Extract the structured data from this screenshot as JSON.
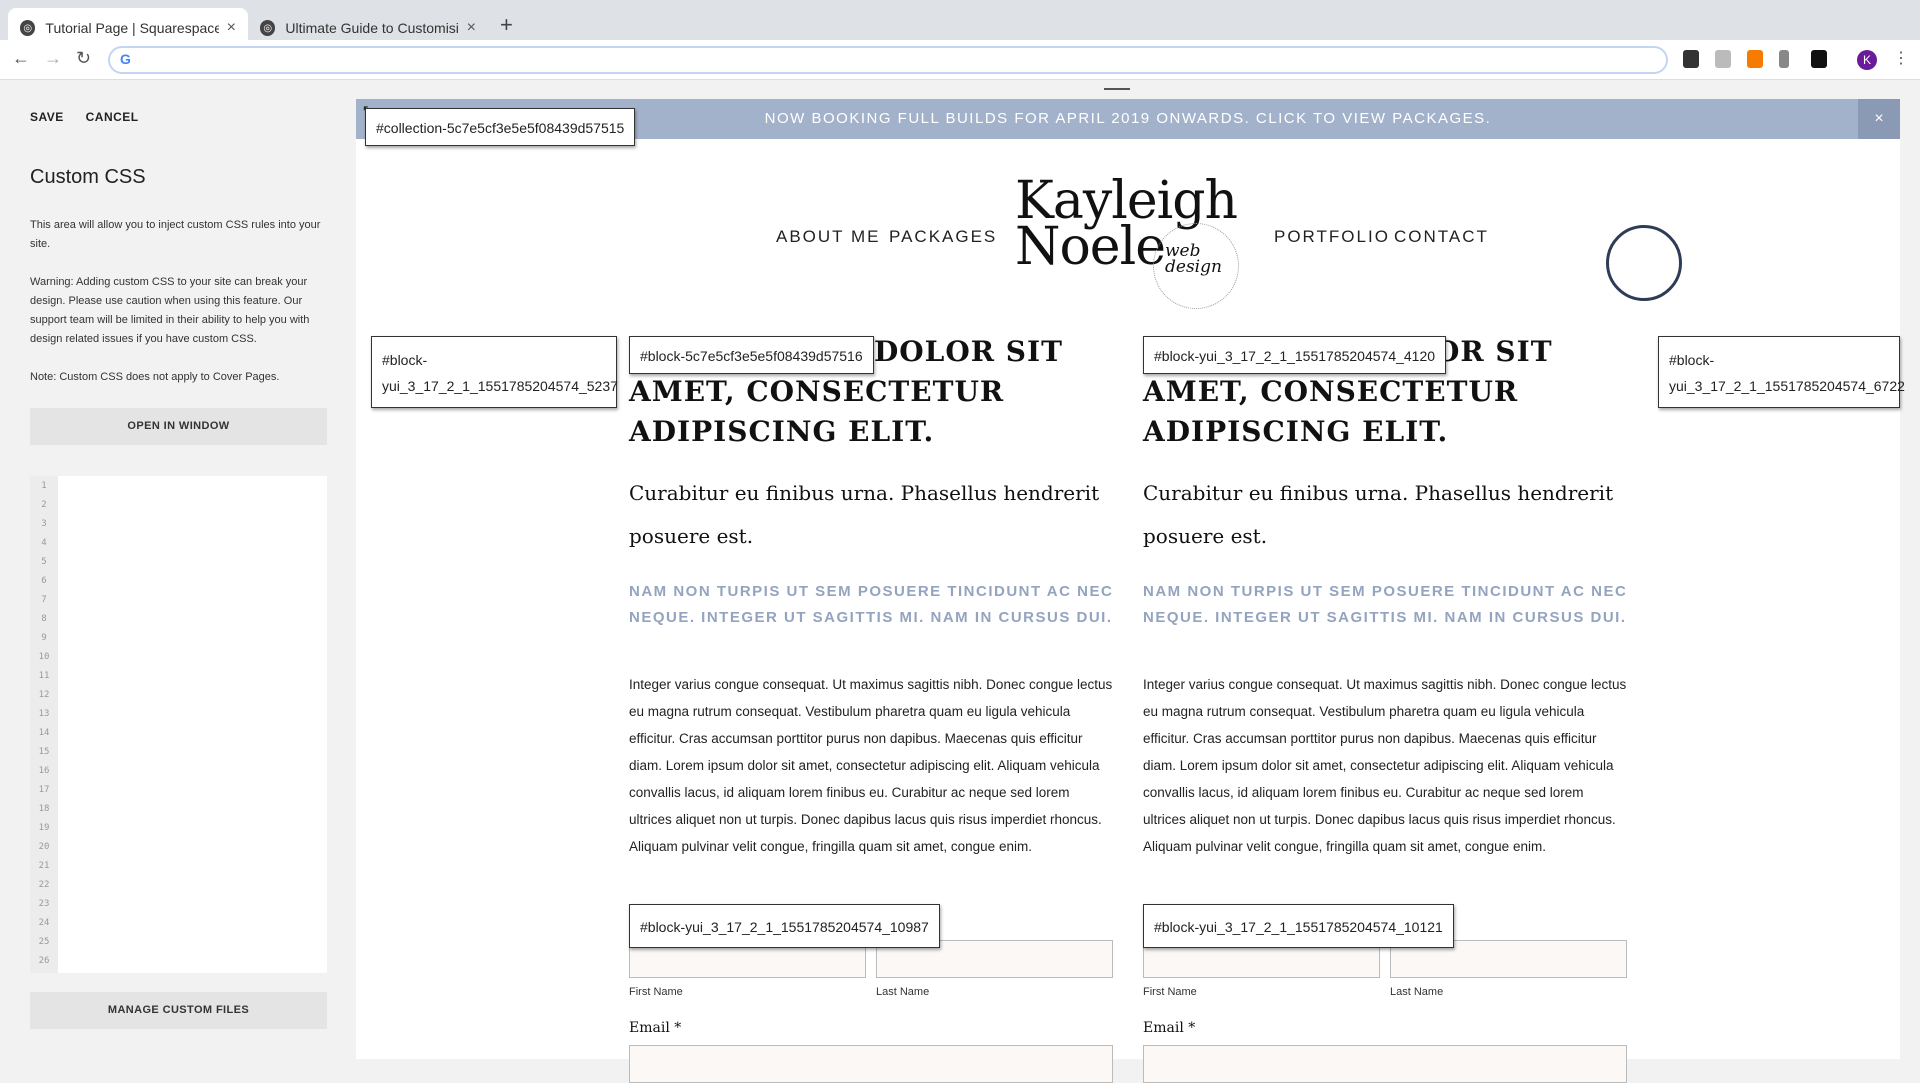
{
  "browser": {
    "tabs": [
      {
        "title": "Tutorial Page | Squarespace Dev",
        "active": true
      },
      {
        "title": "Ultimate Guide to Customising",
        "active": false
      }
    ],
    "new_tab": "+",
    "omnibox_icon": "G",
    "profile_initial": "K"
  },
  "panel": {
    "save": "SAVE",
    "cancel": "CANCEL",
    "title": "Custom CSS",
    "intro": "This area will allow you to inject custom CSS rules into your site.",
    "warning": "Warning: Adding custom CSS to your site can break your design. Please use caution when using this feature. Our support team will be limited in their ability to help you with design related issues if you have custom CSS.",
    "note": "Note: Custom CSS does not apply to Cover Pages.",
    "open_window": "OPEN IN WINDOW",
    "manage_files": "MANAGE CUSTOM FILES",
    "line_numbers": [
      "1",
      "2",
      "3",
      "4",
      "5",
      "6",
      "7",
      "8",
      "9",
      "10",
      "11",
      "12",
      "13",
      "14",
      "15",
      "16",
      "17",
      "18",
      "19",
      "20",
      "21",
      "22",
      "23",
      "24",
      "25",
      "26"
    ]
  },
  "site": {
    "banner": "NOW BOOKING FULL BUILDS FOR APRIL 2019 ONWARDS. CLICK TO VIEW PACKAGES.",
    "banner_close": "×",
    "nav": {
      "about": "ABOUT ME",
      "packages": "PACKAGES",
      "portfolio": "PORTFOLIO",
      "contact": "CONTACT"
    },
    "logo": {
      "line1": "Kayleigh",
      "line2": "Noele",
      "script1": "web",
      "script2": "design"
    },
    "columns": [
      {
        "heading_visible": "DOLOR SIT AMET, CONSECTETUR ADIPISCING ELIT.",
        "subheading": "Curabitur eu finibus urna. Phasellus hendrerit posuere est.",
        "caps": "NAM NON TURPIS UT SEM POSUERE TINCIDUNT AC NEC NEQUE. INTEGER UT SAGITTIS MI. NAM IN CURSUS DUI.",
        "body": "Integer varius congue consequat. Ut maximus sagittis nibh. Donec congue lectus eu magna rutrum consequat. Vestibulum pharetra quam eu ligula vehicula efficitur. Cras accumsan porttitor purus non dapibus. Maecenas quis efficitur diam. Lorem ipsum dolor sit amet, consectetur adipiscing elit. Aliquam vehicula convallis lacus, id aliquam lorem finibus eu. Curabitur ac neque sed lorem ultrices aliquet non ut turpis. Donec dapibus lacus quis risus imperdiet rhoncus. Aliquam pulvinar velit congue, fringilla quam sit amet, congue enim.",
        "first_name": "First Name",
        "last_name": "Last Name",
        "email": "Email *"
      },
      {
        "heading_visible": "OR SIT AMET, CONSECTETUR ADIPISCING ELIT.",
        "subheading": "Curabitur eu finibus urna. Phasellus hendrerit posuere est.",
        "caps": "NAM NON TURPIS UT SEM POSUERE TINCIDUNT AC NEC NEQUE. INTEGER UT SAGITTIS MI. NAM IN CURSUS DUI.",
        "body": "Integer varius congue consequat. Ut maximus sagittis nibh. Donec congue lectus eu magna rutrum consequat. Vestibulum pharetra quam eu ligula vehicula efficitur. Cras accumsan porttitor purus non dapibus. Maecenas quis efficitur diam. Lorem ipsum dolor sit amet, consectetur adipiscing elit. Aliquam vehicula convallis lacus, id aliquam lorem finibus eu. Curabitur ac neque sed lorem ultrices aliquet non ut turpis. Donec dapibus lacus quis risus imperdiet rhoncus. Aliquam pulvinar velit congue, fringilla quam sit amet, congue enim.",
        "first_name": "First Name",
        "last_name": "Last Name",
        "email": "Email *"
      }
    ]
  },
  "id_tags": {
    "collection": "#collection-5c7e5cf3e5e5f08439d57515",
    "block_left_a": "#block-",
    "block_left_b": "yui_3_17_2_1_1551785204574_5237",
    "block_col1": "#block-5c7e5cf3e5e5f08439d57516",
    "block_col2": "#block-yui_3_17_2_1_1551785204574_4120",
    "block_right_a": "#block-",
    "block_right_b": "yui_3_17_2_1_1551785204574_6722",
    "form_col1": "#block-yui_3_17_2_1_1551785204574_10987",
    "form_col2": "#block-yui_3_17_2_1_1551785204574_10121"
  },
  "colors": {
    "banner": "#a3b2cb",
    "accent_caps": "#94a4bf"
  }
}
